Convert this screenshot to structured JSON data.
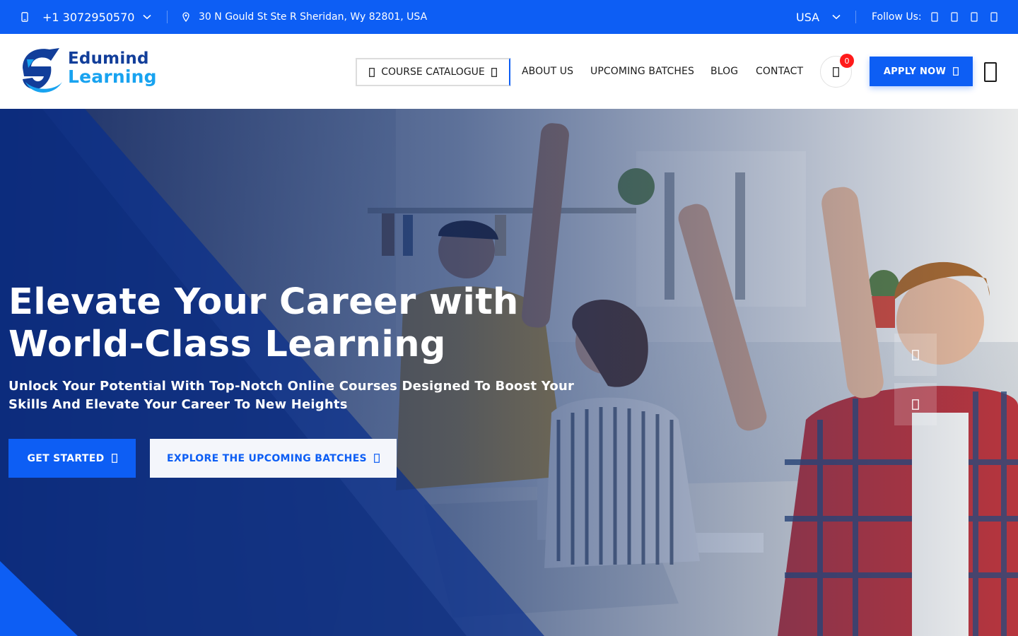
{
  "topbar": {
    "phone": "+1 3072950570",
    "address": "30 N Gould St Ste R Sheridan, Wy 82801, USA",
    "country": "USA",
    "follow_label": "Follow Us:",
    "social_icons": [
      "facebook-icon",
      "twitter-icon",
      "linkedin-icon",
      "instagram-icon"
    ]
  },
  "header": {
    "logo_line1": "Edumind",
    "logo_line2": "Learning",
    "catalogue_label": "COURSE CATALOGUE",
    "nav": [
      {
        "label": "ABOUT US"
      },
      {
        "label": "UPCOMING BATCHES"
      },
      {
        "label": "BLOG"
      },
      {
        "label": "CONTACT"
      }
    ],
    "cart_count": "0",
    "apply_label": "APPLY NOW"
  },
  "hero": {
    "title_line1": "Elevate Your Career with",
    "title_line2": "World-Class Learning",
    "subtitle_line1": "Unlock Your Potential With Top-Notch Online Courses Designed To Boost Your",
    "subtitle_line2": "Skills And Elevate Your Career To New Heights",
    "primary_button": "GET STARTED",
    "secondary_button": "EXPLORE THE UPCOMING BATCHES"
  },
  "colors": {
    "brand_blue": "#0d5ef4",
    "logo_dark": "#123e9a",
    "logo_light": "#18a3f0",
    "badge_red": "#ff1a1a"
  }
}
